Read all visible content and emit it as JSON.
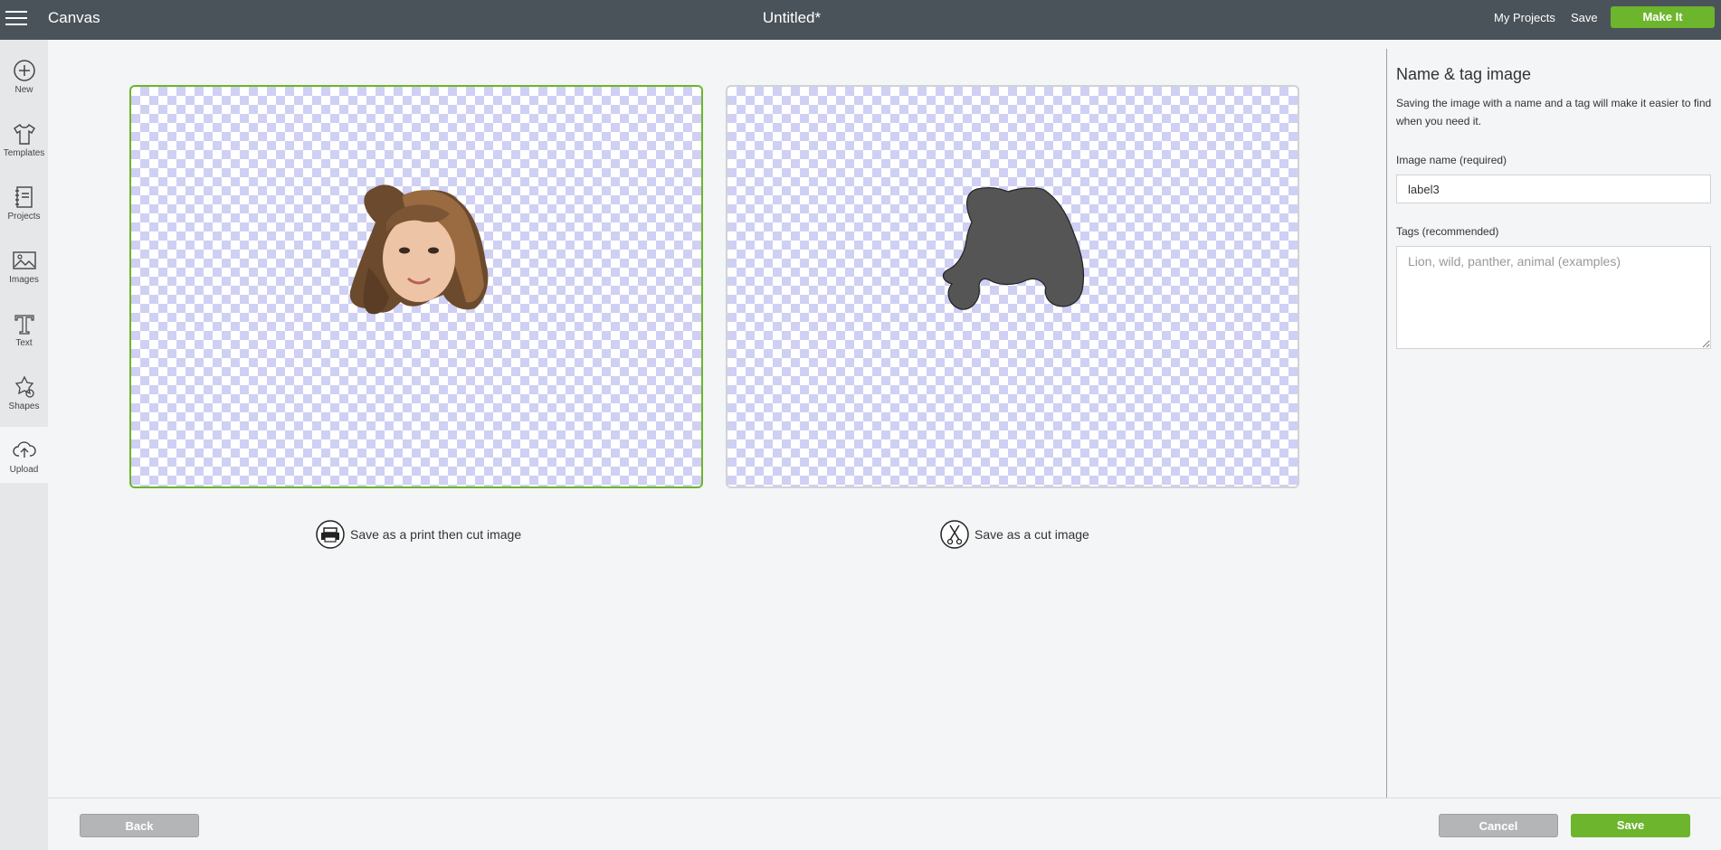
{
  "header": {
    "app_title": "Canvas",
    "doc_title": "Untitled*",
    "my_projects_label": "My Projects",
    "save_label": "Save",
    "make_it_label": "Make It"
  },
  "sidebar": {
    "items": [
      {
        "label": "New",
        "icon": "plus-circle-icon"
      },
      {
        "label": "Templates",
        "icon": "tshirt-icon"
      },
      {
        "label": "Projects",
        "icon": "notebook-icon"
      },
      {
        "label": "Images",
        "icon": "image-icon"
      },
      {
        "label": "Text",
        "icon": "text-icon"
      },
      {
        "label": "Shapes",
        "icon": "shapes-icon"
      },
      {
        "label": "Upload",
        "icon": "cloud-upload-icon"
      }
    ],
    "active": "Upload"
  },
  "main": {
    "print_option_label": "Save as a print then cut image",
    "cut_option_label": "Save as a cut image",
    "selected_option": "print"
  },
  "panel": {
    "title": "Name & tag image",
    "description": "Saving the image with a name and a tag will make it easier to find when you need it.",
    "name_label": "Image name (required)",
    "name_value": "label3",
    "tags_label": "Tags (recommended)",
    "tags_placeholder": "Lion, wild, panther, animal (examples)"
  },
  "footer": {
    "back_label": "Back",
    "cancel_label": "Cancel",
    "save_label": "Save"
  },
  "colors": {
    "topbar": "#4a535a",
    "accent_green": "#6cb52d",
    "checker": "#cfd0f3",
    "cut_silhouette": "#555555"
  }
}
